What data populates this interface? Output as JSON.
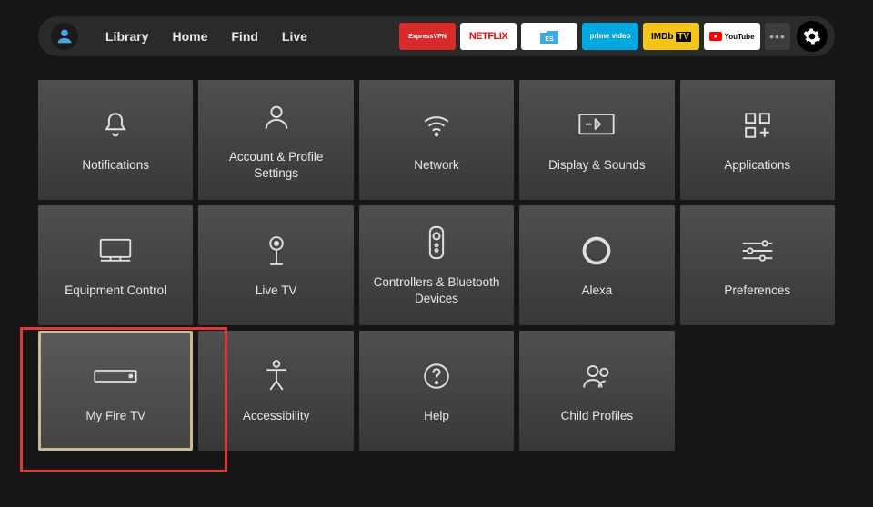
{
  "nav": {
    "items": [
      "Library",
      "Home",
      "Find",
      "Live"
    ]
  },
  "apps": {
    "express": "ExpressVPN",
    "netflix": "NETFLIX",
    "es": "ES",
    "prime": "prime video",
    "imdb": "IMDb TV",
    "youtube": "YouTube",
    "more": "•••"
  },
  "settings": {
    "tiles": [
      {
        "label": "Notifications",
        "icon": "bell-icon"
      },
      {
        "label": "Account & Profile Settings",
        "icon": "user-icon"
      },
      {
        "label": "Network",
        "icon": "wifi-icon"
      },
      {
        "label": "Display & Sounds",
        "icon": "display-icon"
      },
      {
        "label": "Applications",
        "icon": "apps-icon"
      },
      {
        "label": "Equipment Control",
        "icon": "monitor-icon"
      },
      {
        "label": "Live TV",
        "icon": "antenna-icon"
      },
      {
        "label": "Controllers & Bluetooth Devices",
        "icon": "remote-icon"
      },
      {
        "label": "Alexa",
        "icon": "alexa-icon"
      },
      {
        "label": "Preferences",
        "icon": "sliders-icon"
      },
      {
        "label": "My Fire TV",
        "icon": "device-icon",
        "selected": true
      },
      {
        "label": "Accessibility",
        "icon": "accessibility-icon"
      },
      {
        "label": "Help",
        "icon": "help-icon"
      },
      {
        "label": "Child Profiles",
        "icon": "child-icon"
      }
    ]
  },
  "annotation": {
    "highlight_index": 10
  }
}
